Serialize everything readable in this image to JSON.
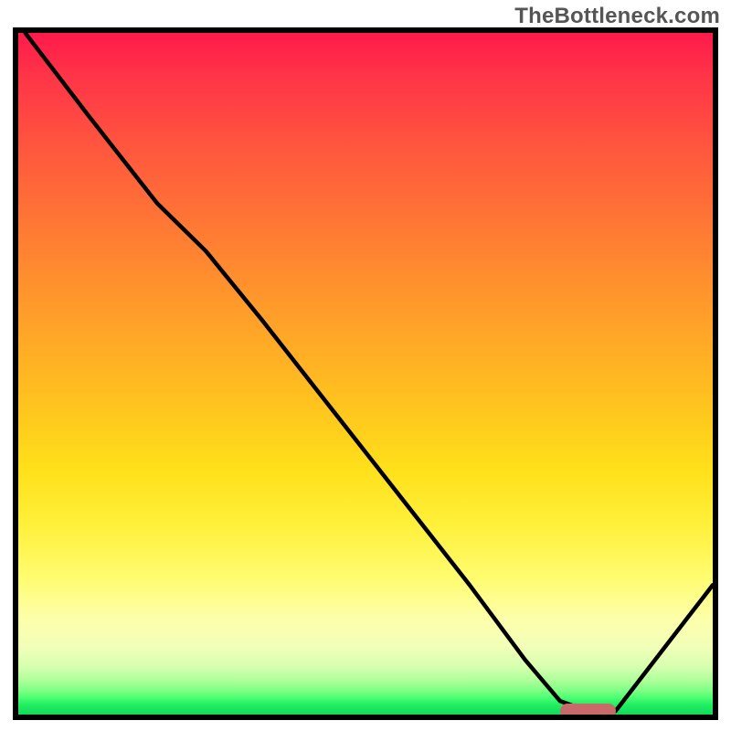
{
  "watermark": "TheBottleneck.com",
  "chart_data": {
    "type": "line",
    "title": "",
    "xlabel": "",
    "ylabel": "",
    "xlim": [
      0,
      100
    ],
    "ylim": [
      0,
      100
    ],
    "series": [
      {
        "name": "curve",
        "x": [
          1,
          10,
          20,
          27,
          35,
          45,
          55,
          65,
          73,
          78,
          82,
          86,
          100
        ],
        "values": [
          100,
          88,
          75,
          68,
          58,
          45,
          32,
          19,
          8,
          2,
          0.5,
          0.5,
          19
        ]
      }
    ],
    "optimal_marker": {
      "x_start": 78,
      "x_end": 86,
      "y": 0.5
    },
    "gradient_stops": [
      {
        "pct": 0,
        "color": "#ff1a4a"
      },
      {
        "pct": 30,
        "color": "#ff7d33"
      },
      {
        "pct": 64,
        "color": "#ffe01a"
      },
      {
        "pct": 86,
        "color": "#fdffab"
      },
      {
        "pct": 100,
        "color": "#12d95a"
      }
    ]
  }
}
